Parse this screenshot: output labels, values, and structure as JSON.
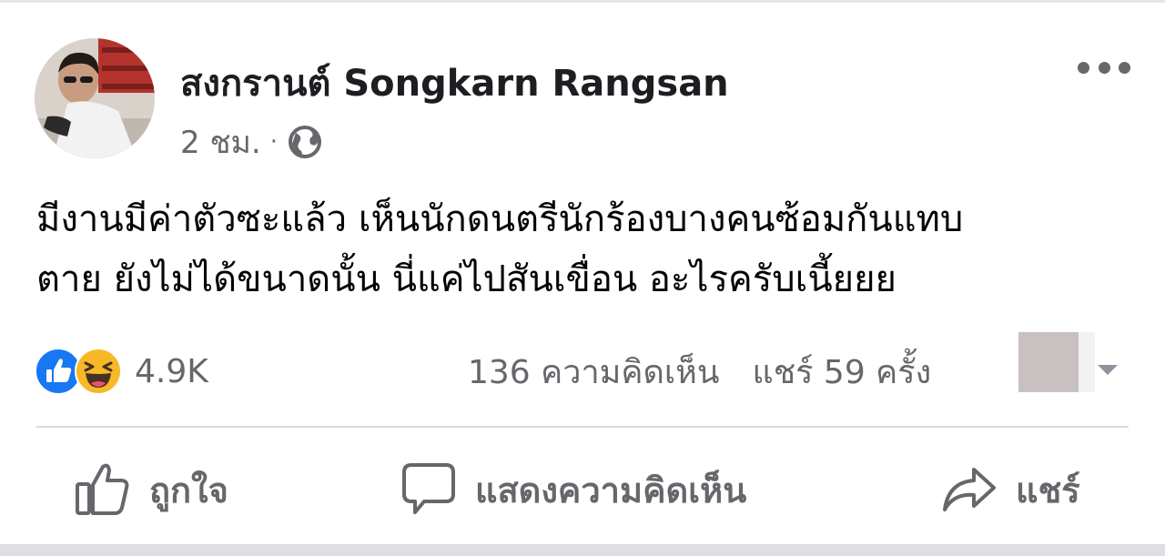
{
  "post": {
    "author": "สงกรานต์ Songkarn Rangsan",
    "timestamp": "2 ชม.",
    "separator": "·",
    "privacy_icon": "globe-icon",
    "more_icon": "more-options-icon",
    "text_lines": [
      "มีงานมีค่าตัวซะแล้ว เห็นนักดนตรีนักร้องบางคนซ้อมกันแทบ",
      "ตาย ยังไม่ได้ขนาดนั้น นี่แค่ไปสันเขื่อน อะไรครับเนี้ยยย"
    ]
  },
  "engagement": {
    "reaction_icons": [
      "like-reaction-icon",
      "haha-reaction-icon"
    ],
    "reaction_count": "4.9K",
    "comments": "136 ความคิดเห็น",
    "shares": "แชร์ 59 ครั้ง"
  },
  "actions": {
    "like_label": "ถูกใจ",
    "comment_label": "แสดงความคิดเห็น",
    "share_label": "แชร์"
  },
  "colors": {
    "like_blue": "#1877f2",
    "haha_yellow": "#f7b928",
    "text_primary": "#050505",
    "text_secondary": "#65676b",
    "divider": "#dadde1"
  }
}
